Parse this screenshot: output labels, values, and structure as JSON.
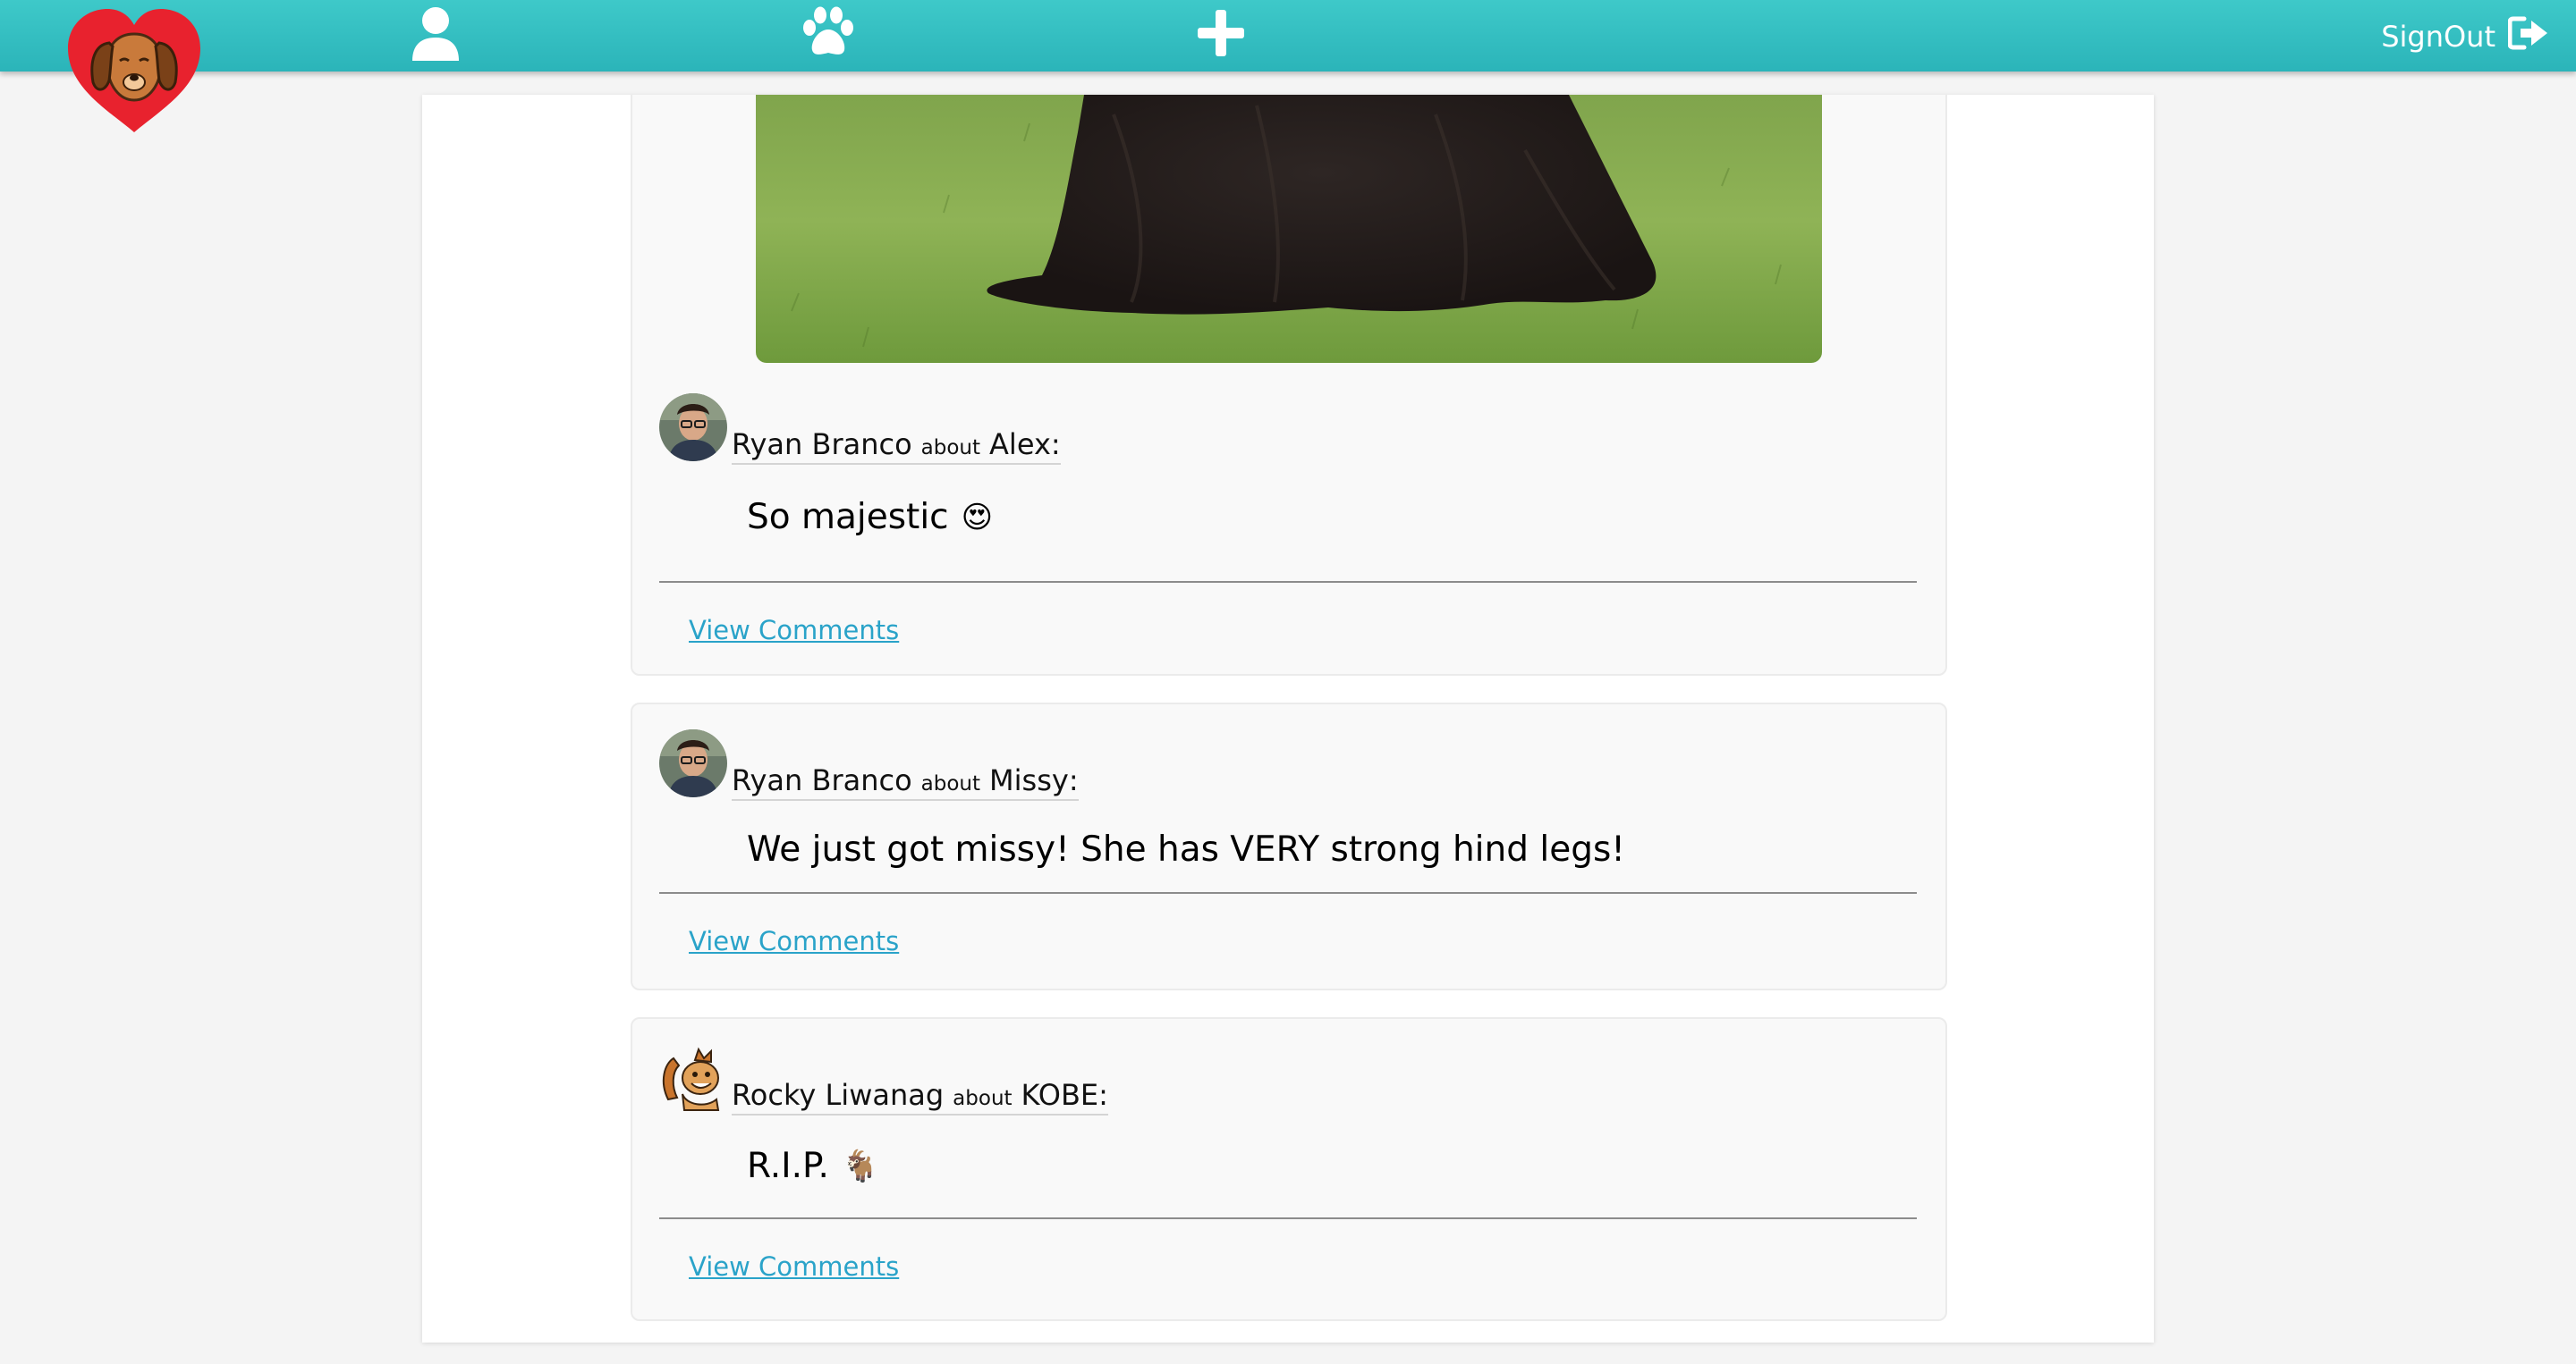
{
  "nav": {
    "signout_label": "SignOut",
    "icons": [
      "profile-icon",
      "paw-icon",
      "plus-icon",
      "sign-out-icon"
    ],
    "colors": {
      "bar": "#3ec9c9",
      "logo_heart": "#e8222e",
      "link": "#2aa3c9"
    }
  },
  "posts": [
    {
      "author": "Ryan Branco",
      "about_word": "about",
      "pet": "Alex",
      "colon": ":",
      "text": "So majestic",
      "emoji": "😍",
      "link_label": "View Comments"
    },
    {
      "author": "Ryan Branco",
      "about_word": "about",
      "pet": "Missy",
      "colon": ":",
      "text": "We just got missy! She has VERY strong hind legs!",
      "link_label": "View Comments"
    },
    {
      "author": "Rocky Liwanag",
      "about_word": "about",
      "pet": "KOBE",
      "colon": ":",
      "text": "R.I.P.",
      "emoji": "🐐",
      "link_label": "View Comments"
    }
  ]
}
